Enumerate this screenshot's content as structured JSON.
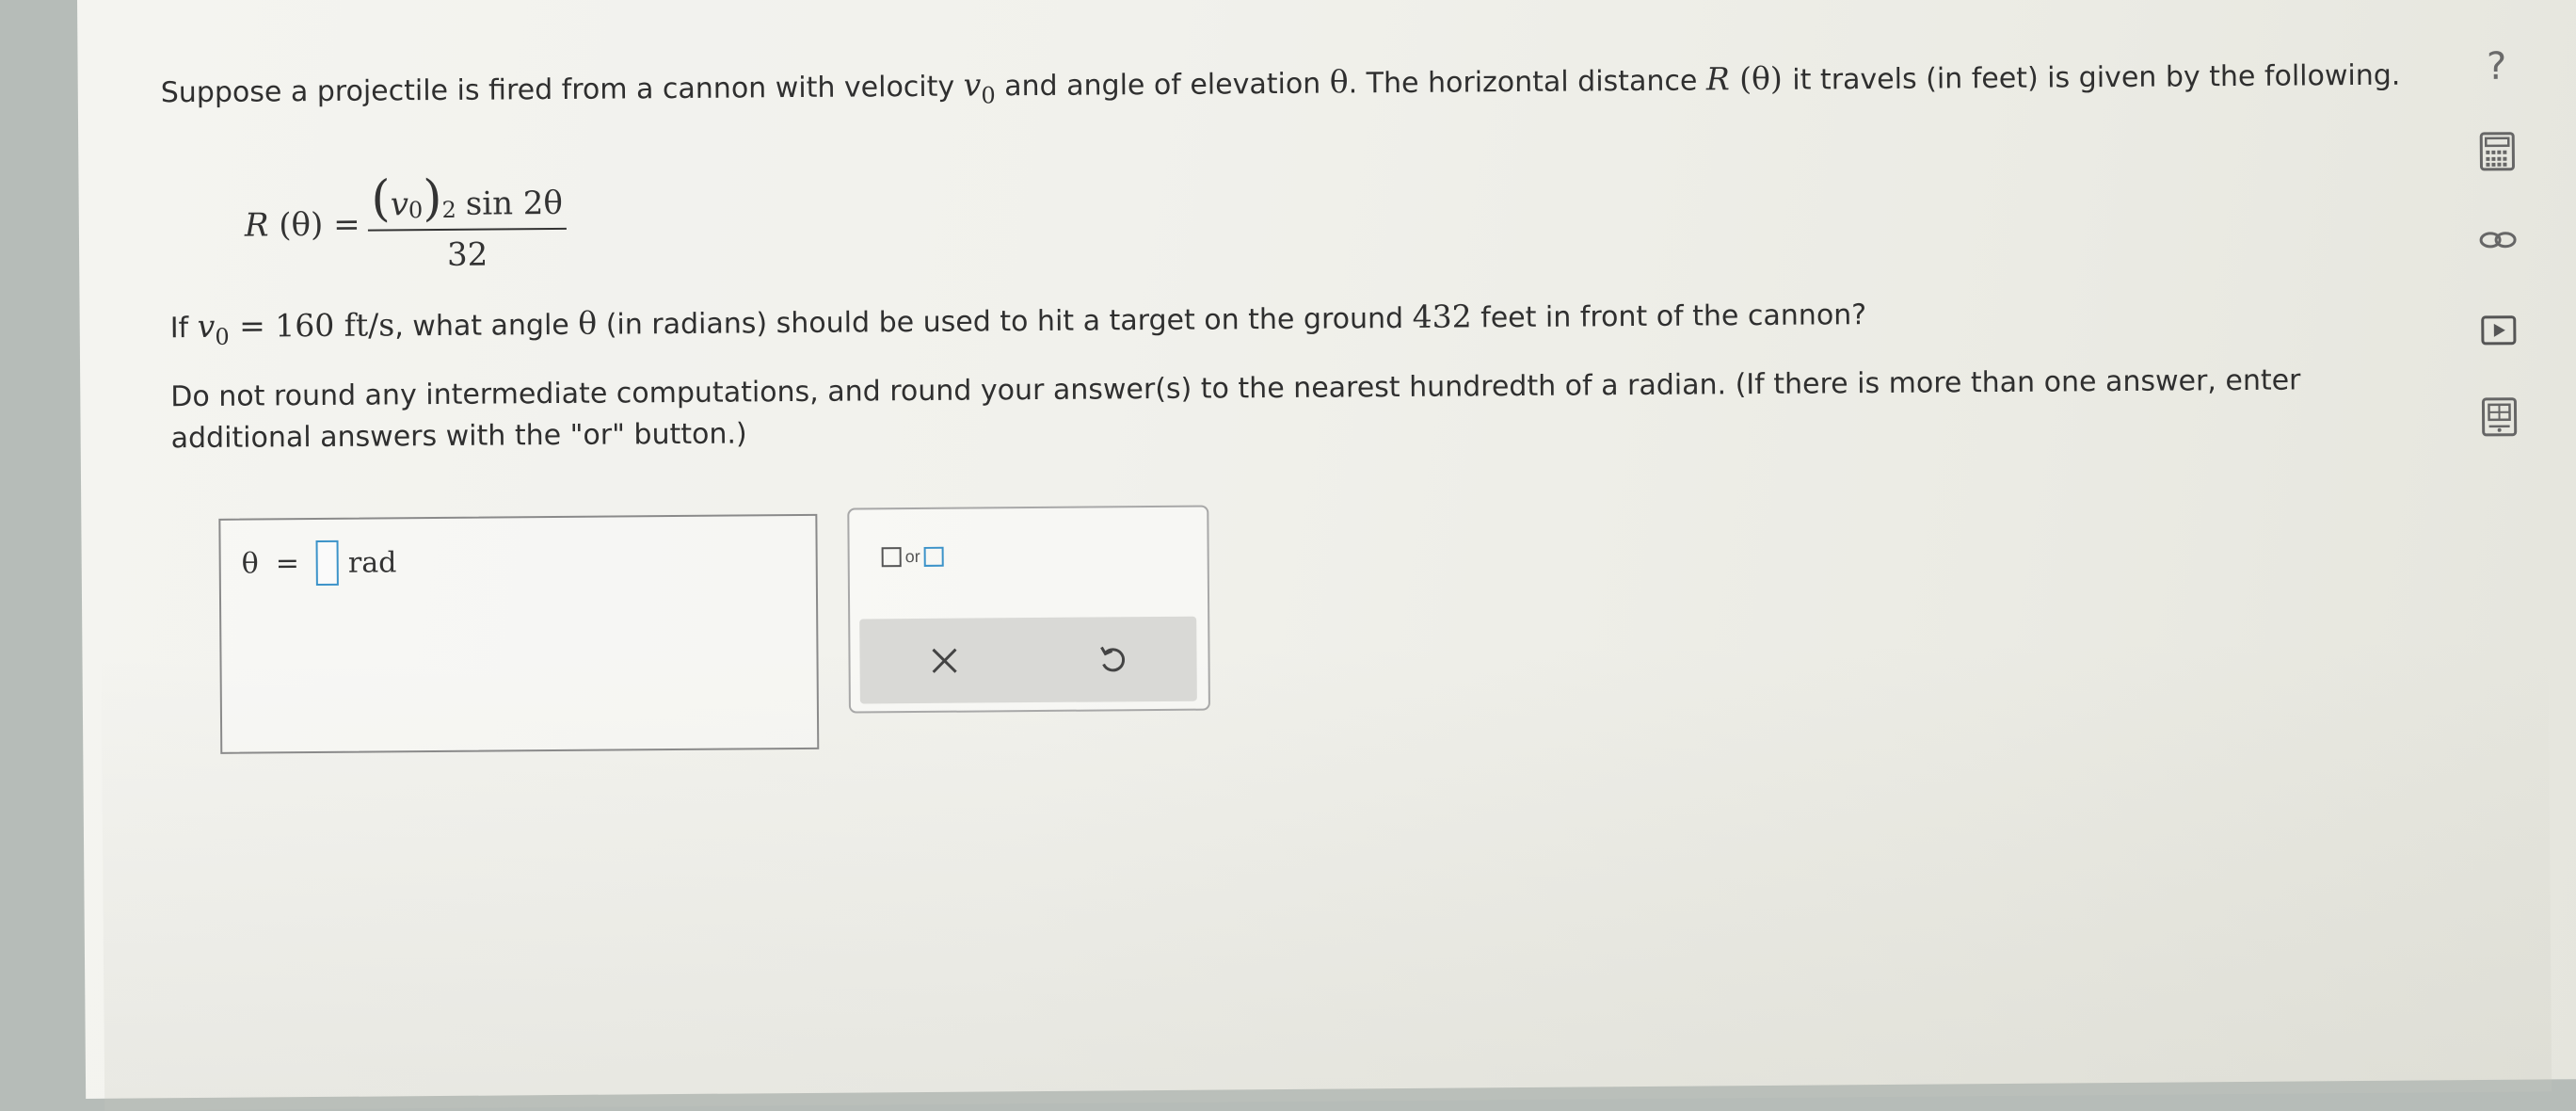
{
  "problem": {
    "intro_a": "Suppose a projectile is fired from a cannon with velocity ",
    "v": "v",
    "sub0": "0",
    "intro_b": " and angle of elevation ",
    "theta": "θ",
    "intro_c": ". The horizontal distance ",
    "R": "R",
    "R_arg": " (θ) ",
    "intro_d": "it travels (in feet) is given by the following.",
    "formula": {
      "lhs": "R (θ) =",
      "paren_open": "(",
      "paren_close": ")",
      "v": "v",
      "sub0": "0",
      "exp": "2",
      "sin": "sin 2θ",
      "denominator": "32"
    },
    "question_a": "If ",
    "question_eq": " = 160 ft/s",
    "question_b": ", what angle ",
    "question_c": " (in radians) should be used to hit a target on the ground ",
    "question_num": "432",
    "question_d": " feet in front of the cannon?",
    "instructions": "Do not round any intermediate computations, and round your answer(s) to the nearest hundredth of a radian. (If there is more than one answer, enter additional answers with the \"or\" button.)"
  },
  "answer": {
    "variable": "θ",
    "equals": "=",
    "value": "",
    "unit": "rad"
  },
  "tools": {
    "or_label": "or",
    "clear_icon": "x-icon",
    "undo_icon": "undo-icon"
  },
  "toolbar": {
    "help_label": "?",
    "icons": [
      "help-icon",
      "calculator-icon",
      "link-icon",
      "video-icon",
      "table-icon"
    ]
  },
  "colors": {
    "input_border": "#3c93c9",
    "text": "#2f2f2f",
    "icon": "#6a6a6a"
  }
}
